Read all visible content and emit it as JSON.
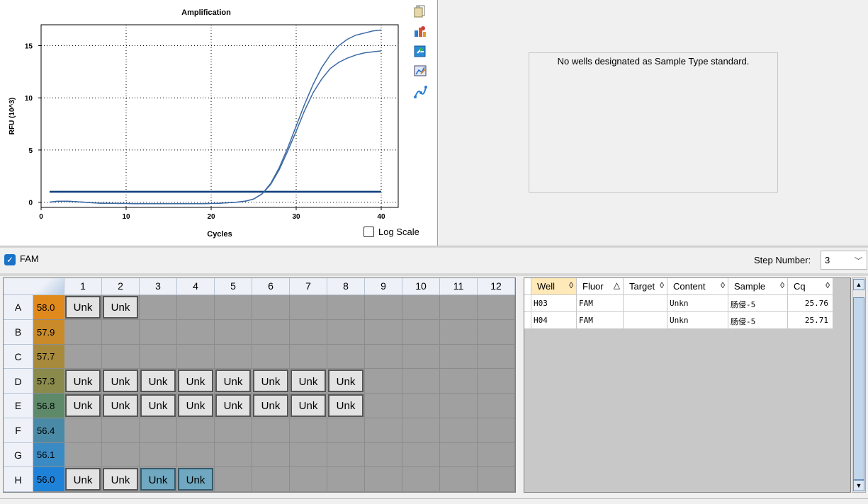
{
  "chart": {
    "title": "Amplification",
    "log_scale_label": "Log Scale",
    "log_scale_checked": false
  },
  "chart_data": {
    "type": "line",
    "title": "Amplification",
    "xlabel": "Cycles",
    "ylabel": "RFU (10^3)",
    "xlim": [
      0,
      42
    ],
    "ylim": [
      -0.5,
      17
    ],
    "xticks": [
      0,
      10,
      20,
      30,
      40
    ],
    "yticks": [
      0,
      5,
      10,
      15
    ],
    "grid": true,
    "threshold": 1.0,
    "series": [
      {
        "x": [
          1,
          2,
          3,
          4,
          5,
          6,
          7,
          8,
          9,
          10,
          11,
          12,
          13,
          14,
          15,
          16,
          17,
          18,
          19,
          20,
          21,
          22,
          23,
          24,
          25,
          26,
          27,
          28,
          29,
          30,
          31,
          32,
          33,
          34,
          35,
          36,
          37,
          38,
          39,
          40
        ],
        "values": [
          0.0,
          0.1,
          0.1,
          0.05,
          0.0,
          -0.05,
          -0.1,
          -0.1,
          -0.12,
          -0.12,
          -0.15,
          -0.15,
          -0.15,
          -0.15,
          -0.15,
          -0.15,
          -0.15,
          -0.15,
          -0.15,
          -0.12,
          -0.1,
          -0.05,
          0.0,
          0.1,
          0.3,
          0.8,
          1.8,
          3.3,
          5.2,
          7.3,
          9.4,
          11.3,
          12.9,
          14.1,
          15.0,
          15.6,
          16.0,
          16.2,
          16.4,
          16.5
        ]
      },
      {
        "x": [
          1,
          2,
          3,
          4,
          5,
          6,
          7,
          8,
          9,
          10,
          11,
          12,
          13,
          14,
          15,
          16,
          17,
          18,
          19,
          20,
          21,
          22,
          23,
          24,
          25,
          26,
          27,
          28,
          29,
          30,
          31,
          32,
          33,
          34,
          35,
          36,
          37,
          38,
          39,
          40
        ],
        "values": [
          0.0,
          0.1,
          0.1,
          0.05,
          0.0,
          -0.05,
          -0.1,
          -0.1,
          -0.12,
          -0.12,
          -0.15,
          -0.15,
          -0.15,
          -0.15,
          -0.15,
          -0.15,
          -0.15,
          -0.15,
          -0.15,
          -0.12,
          -0.1,
          -0.05,
          0.0,
          0.1,
          0.3,
          0.8,
          1.7,
          3.1,
          4.9,
          6.8,
          8.8,
          10.5,
          11.8,
          12.8,
          13.4,
          13.8,
          14.1,
          14.3,
          14.4,
          14.5
        ]
      }
    ]
  },
  "toolbar_icons": [
    "copy-icon",
    "export-chart-icon",
    "export-data-icon",
    "chart-settings-icon",
    "curve-tool-icon"
  ],
  "std_curve": {
    "message": "No wells designated as Sample Type standard."
  },
  "fluor": {
    "label": "FAM",
    "checked": true,
    "step_label": "Step Number:",
    "step_value": "3"
  },
  "plate": {
    "columns": [
      "1",
      "2",
      "3",
      "4",
      "5",
      "6",
      "7",
      "8",
      "9",
      "10",
      "11",
      "12"
    ],
    "rows": [
      {
        "label": "A",
        "temp": "58.0",
        "color": "#e08a1e",
        "wells": [
          "Unk",
          "Unk",
          "",
          "",
          "",
          "",
          "",
          "",
          "",
          "",
          "",
          ""
        ],
        "sel": []
      },
      {
        "label": "B",
        "temp": "57.9",
        "color": "#c98a2a",
        "wells": [
          "",
          "",
          "",
          "",
          "",
          "",
          "",
          "",
          "",
          "",
          "",
          ""
        ],
        "sel": []
      },
      {
        "label": "C",
        "temp": "57.7",
        "color": "#a78a3c",
        "wells": [
          "",
          "",
          "",
          "",
          "",
          "",
          "",
          "",
          "",
          "",
          "",
          ""
        ],
        "sel": []
      },
      {
        "label": "D",
        "temp": "57.3",
        "color": "#8a8a4c",
        "wells": [
          "Unk",
          "Unk",
          "Unk",
          "Unk",
          "Unk",
          "Unk",
          "Unk",
          "Unk",
          "",
          "",
          "",
          ""
        ],
        "sel": []
      },
      {
        "label": "E",
        "temp": "56.8",
        "color": "#5e8a6a",
        "wells": [
          "Unk",
          "Unk",
          "Unk",
          "Unk",
          "Unk",
          "Unk",
          "Unk",
          "Unk",
          "",
          "",
          "",
          ""
        ],
        "sel": []
      },
      {
        "label": "F",
        "temp": "56.4",
        "color": "#4a8aa6",
        "wells": [
          "",
          "",
          "",
          "",
          "",
          "",
          "",
          "",
          "",
          "",
          "",
          ""
        ],
        "sel": []
      },
      {
        "label": "G",
        "temp": "56.1",
        "color": "#3a8ac4",
        "wells": [
          "",
          "",
          "",
          "",
          "",
          "",
          "",
          "",
          "",
          "",
          "",
          ""
        ],
        "sel": []
      },
      {
        "label": "H",
        "temp": "56.0",
        "color": "#1e82d8",
        "wells": [
          "Unk",
          "Unk",
          "Unk",
          "Unk",
          "",
          "",
          "",
          "",
          "",
          "",
          "",
          ""
        ],
        "sel": [
          2,
          3
        ]
      }
    ]
  },
  "table": {
    "columns": [
      {
        "label": "Well",
        "arrow": "◊",
        "sorted": true
      },
      {
        "label": "Fluor",
        "arrow": "△",
        "sorted": false
      },
      {
        "label": "Target",
        "arrow": "◊",
        "sorted": false
      },
      {
        "label": "Content",
        "arrow": "◊",
        "sorted": false
      },
      {
        "label": "Sample",
        "arrow": "◊",
        "sorted": false
      },
      {
        "label": "Cq",
        "arrow": "◊",
        "sorted": false
      }
    ],
    "rows": [
      [
        "H03",
        "FAM",
        "",
        "Unkn",
        "肠侵-5",
        "25.76"
      ],
      [
        "H04",
        "FAM",
        "",
        "Unkn",
        "肠侵-5",
        "25.71"
      ]
    ]
  }
}
